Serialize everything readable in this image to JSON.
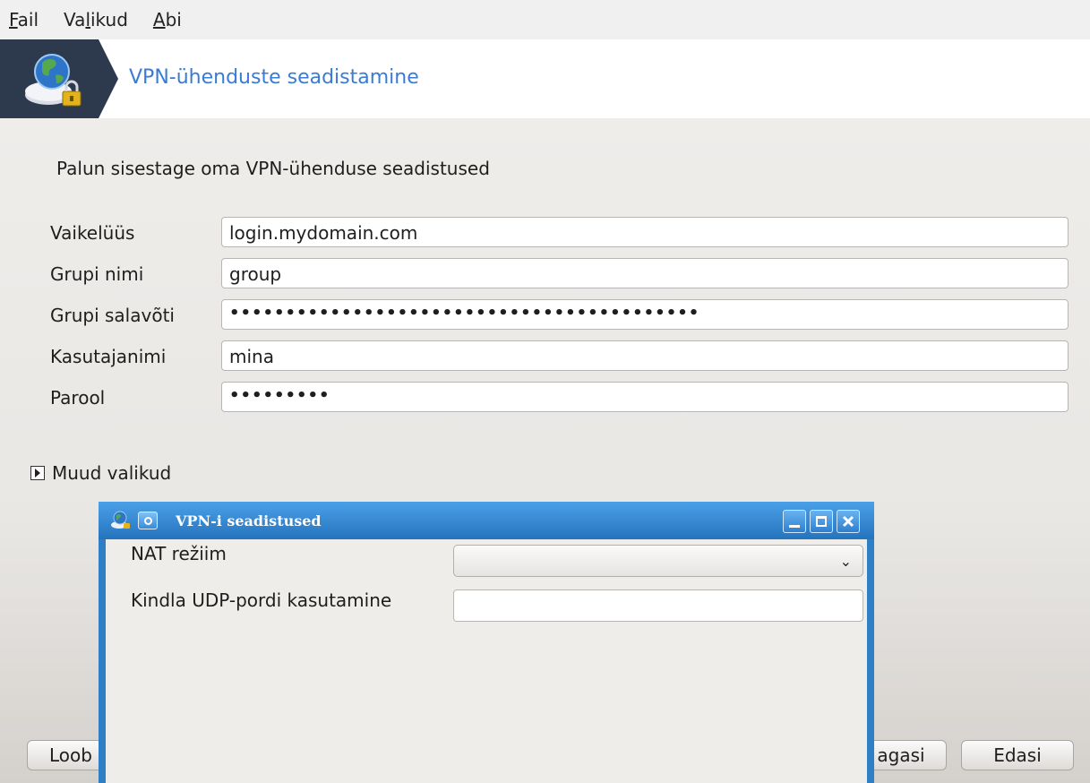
{
  "menubar": {
    "items": [
      {
        "mnemonic": "F",
        "rest": "ail"
      },
      {
        "pre": "Va",
        "mnemonic": "l",
        "rest": "ikud"
      },
      {
        "mnemonic": "A",
        "rest": "bi"
      }
    ]
  },
  "header": {
    "title": "VPN-ühenduste seadistamine",
    "icon": "network-globe-lock-icon"
  },
  "main": {
    "instruction": "Palun sisestage oma VPN-ühenduse seadistused",
    "fields": [
      {
        "label": "Vaikelüüs",
        "value": "login.mydomain.com"
      },
      {
        "label": "Grupi nimi",
        "value": "group"
      },
      {
        "label": "Grupi salavõti",
        "value": "••••••••••••••••••••••••••••••••••••••••••"
      },
      {
        "label": "Kasutajanimi",
        "value": "mina"
      },
      {
        "label": "Parool",
        "value": "•••••••••"
      }
    ],
    "more_options": "Muud valikud"
  },
  "buttons": {
    "cancel": "Loob",
    "back": "agasi",
    "next": "Edasi"
  },
  "dialog": {
    "title": "VPN-i seadistused",
    "nat_label": "NAT režiim",
    "nat_value": "",
    "udp_label": "Kindla UDP-pordi kasutamine",
    "udp_value": ""
  },
  "colors": {
    "banner_dark": "#2d3a4e",
    "banner_title": "#3a7bd5",
    "dialog_frame": "#2f7fc7"
  }
}
